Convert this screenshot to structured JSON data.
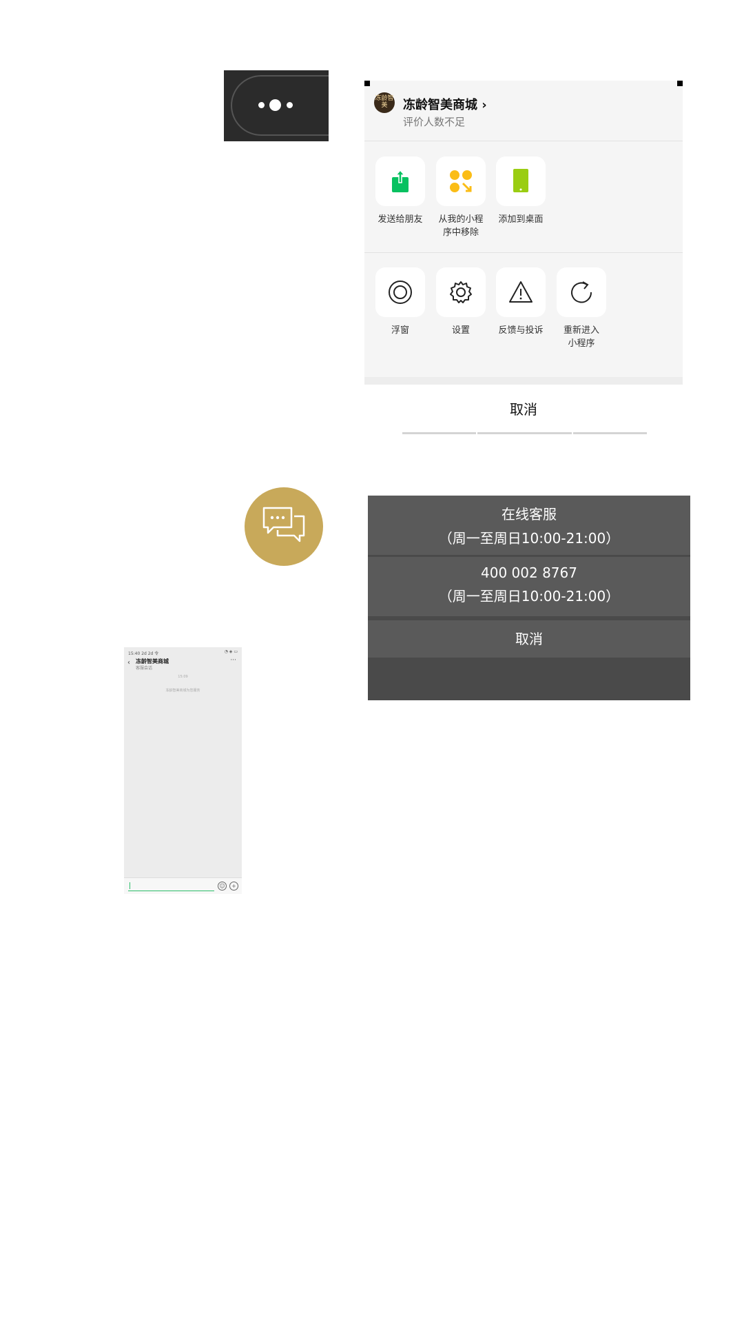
{
  "menu": {
    "avatar_text": "冻龄智美",
    "app_name": "冻龄智美商城",
    "rating_text": "评价人数不足",
    "row1": [
      {
        "label": "发送给朋友",
        "icon": "share-icon"
      },
      {
        "label": "从我的小程\n序中移除",
        "icon": "remove-miniprogram-icon"
      },
      {
        "label": "添加到桌面",
        "icon": "add-to-desktop-icon"
      }
    ],
    "row2": [
      {
        "label": "浮窗",
        "icon": "float-window-icon"
      },
      {
        "label": "设置",
        "icon": "gear-icon"
      },
      {
        "label": "反馈与投诉",
        "icon": "warning-icon"
      },
      {
        "label": "重新进入\n小程序",
        "icon": "reload-icon"
      }
    ],
    "cancel": "取消",
    "colors": {
      "share": "#07c160",
      "remove": "#fbbd16",
      "desktop": "#9acd12"
    }
  },
  "service_sheet": {
    "online_title": "在线客服",
    "online_hours": "（周一至周日10:00-21:00）",
    "phone_number": "400 002 8767",
    "phone_hours": "（周一至周日10:00-21:00）",
    "cancel": "取消"
  },
  "chat_button": {
    "icon": "chat-bubbles-icon",
    "color": "#c8a95a"
  },
  "phone_screen": {
    "status_time": "15:40 2d 2d 令",
    "status_icons": "◔ ◈ ▭",
    "title": "冻龄智美商城",
    "subtitle": "客服会话",
    "time": "15:09",
    "notice": "冻龄智美商城为您服务",
    "more": "···",
    "back": "‹"
  }
}
